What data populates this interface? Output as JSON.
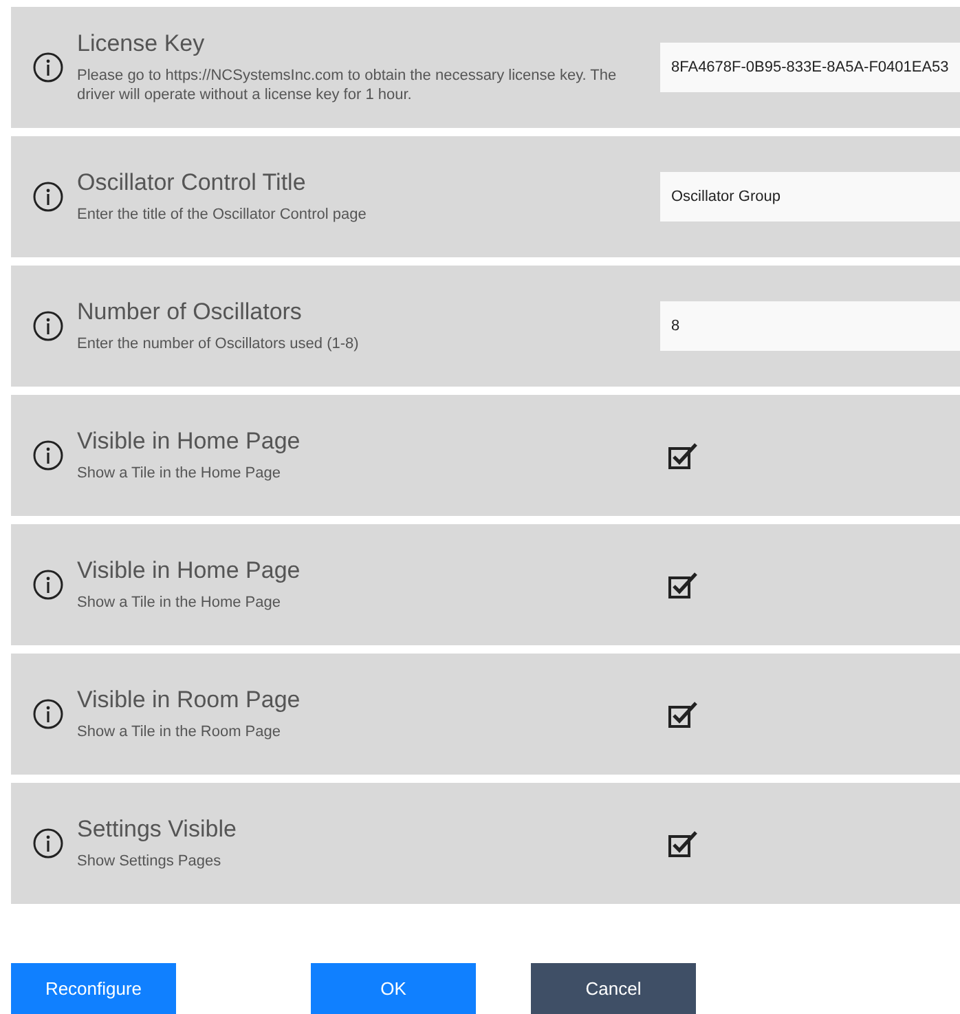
{
  "settings": [
    {
      "title": "License Key",
      "description": "Please go to https://NCSystemsInc.com to obtain the necessary license key. The driver will operate without a license key for 1 hour.",
      "kind": "text",
      "value": "8FA4678F-0B95-833E-8A5A-F0401EA53"
    },
    {
      "title": "Oscillator Control Title",
      "description": "Enter the title of the Oscillator Control page",
      "kind": "text",
      "value": "Oscillator Group"
    },
    {
      "title": "Number of Oscillators",
      "description": "Enter the number of Oscillators used (1-8)",
      "kind": "text",
      "value": "8"
    },
    {
      "title": "Visible in Home Page",
      "description": "Show a Tile in the Home Page",
      "kind": "checkbox",
      "checked": true
    },
    {
      "title": "Visible in Home Page",
      "description": "Show a Tile in the Home Page",
      "kind": "checkbox",
      "checked": true
    },
    {
      "title": "Visible in Room Page",
      "description": "Show a Tile in the Room Page",
      "kind": "checkbox",
      "checked": true
    },
    {
      "title": "Settings Visible",
      "description": "Show Settings Pages",
      "kind": "checkbox",
      "checked": true
    }
  ],
  "buttons": [
    {
      "label": "Reconfigure",
      "kind": "primary"
    },
    {
      "label": "OK",
      "kind": "primary"
    },
    {
      "label": "Cancel",
      "kind": "secondary"
    }
  ]
}
